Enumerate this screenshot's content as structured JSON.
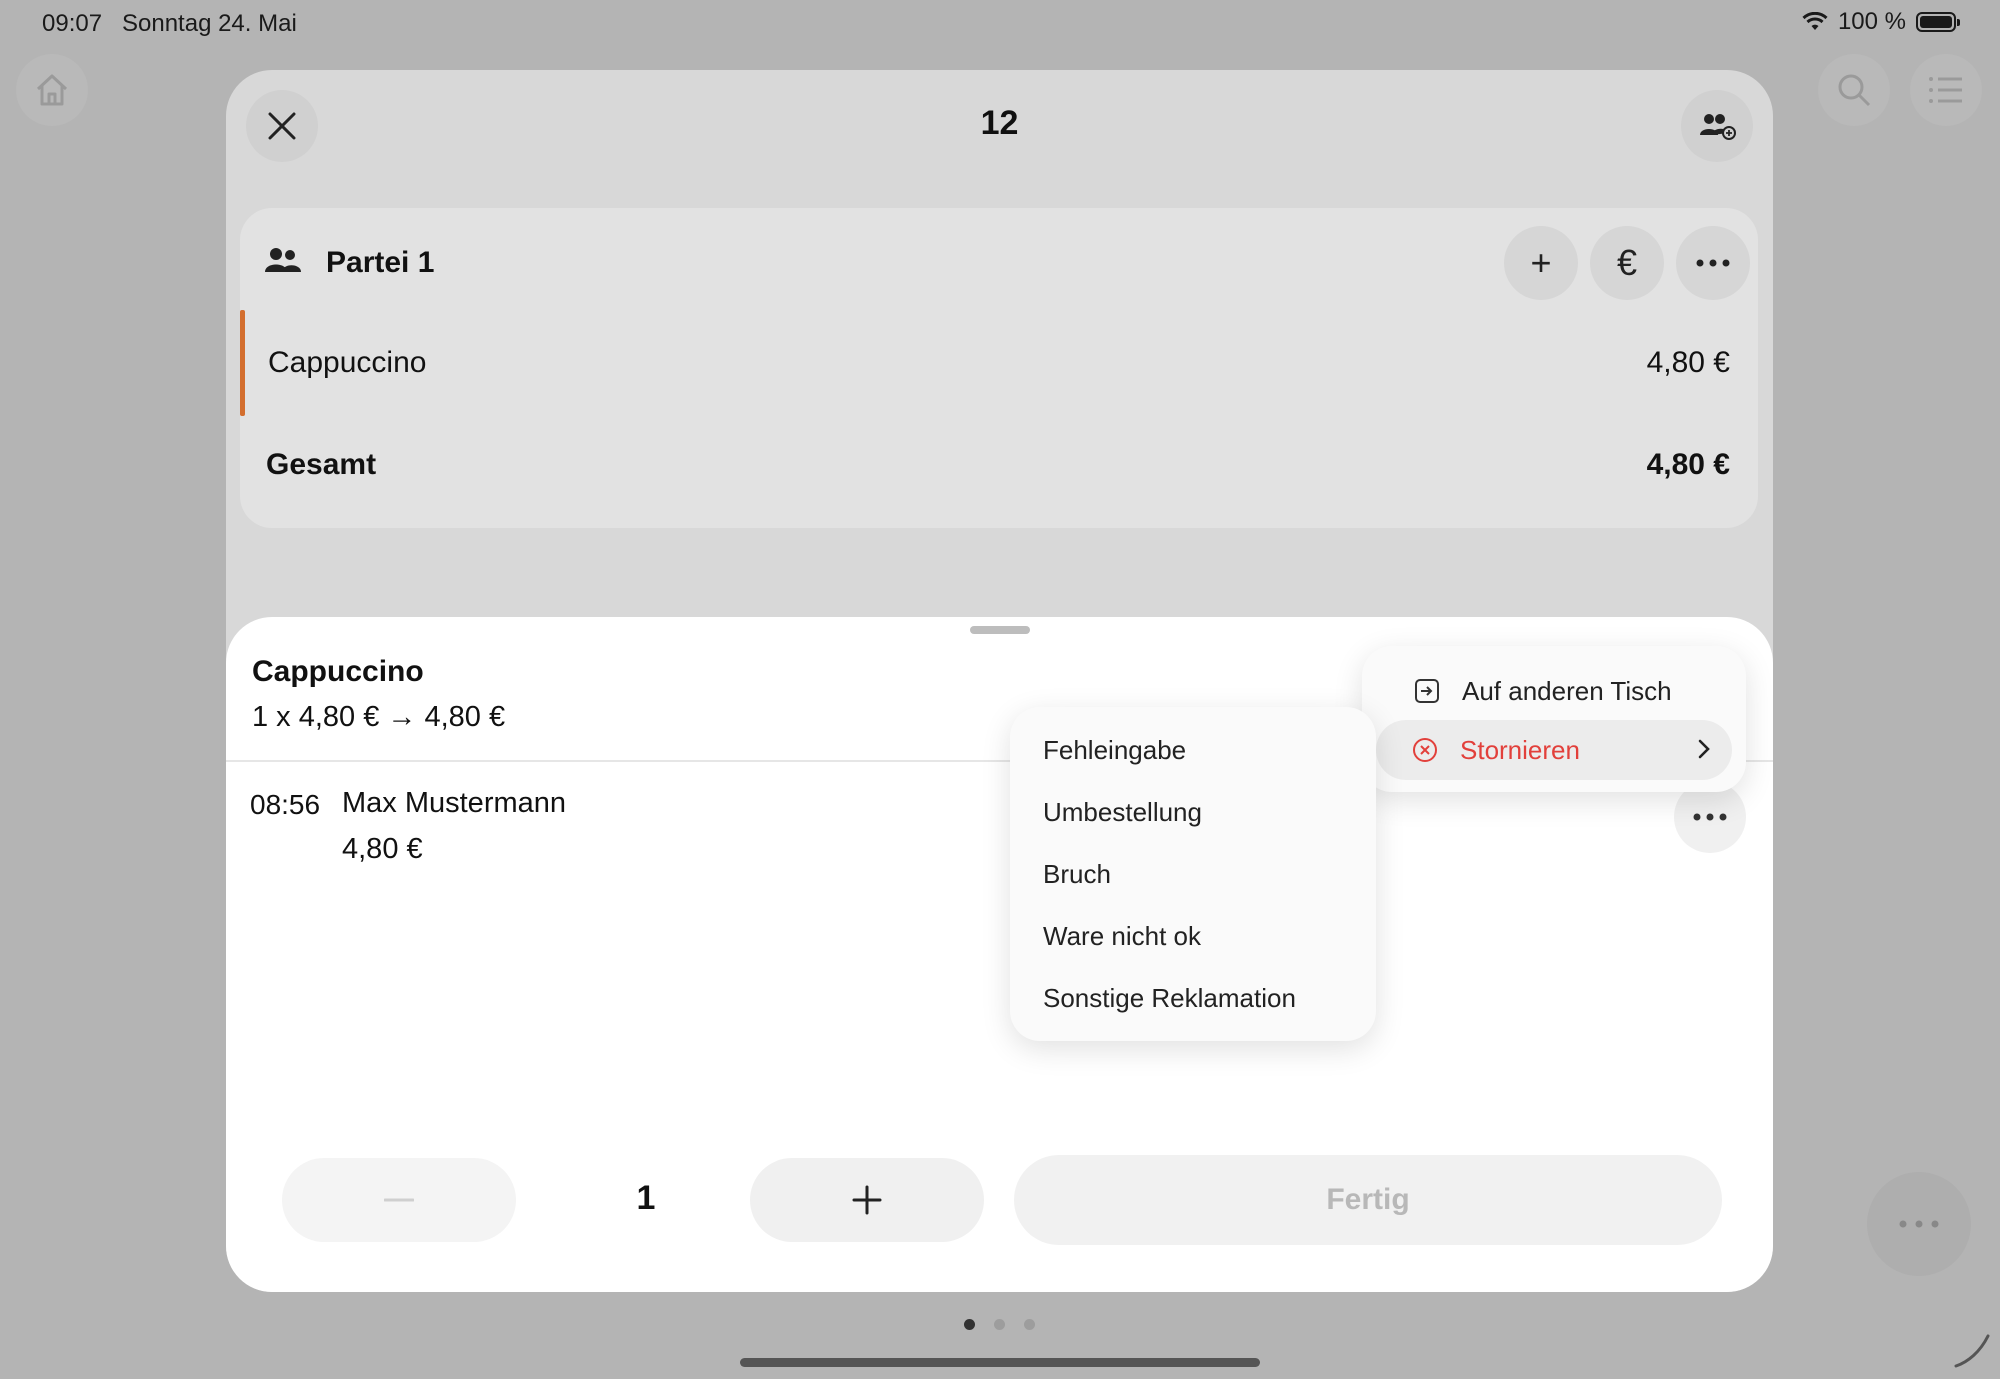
{
  "status_bar": {
    "time": "09:07",
    "date": "Sonntag 24. Mai",
    "battery": "100 %"
  },
  "modal": {
    "title": "12",
    "party": {
      "label": "Partei 1",
      "items": [
        {
          "name": "Cappuccino",
          "price": "4,80 €"
        }
      ],
      "total_label": "Gesamt",
      "total_price": "4,80 €",
      "actions": {
        "add": "+",
        "pay": "€"
      }
    }
  },
  "sheet": {
    "title": "Cappuccino",
    "calc": "1 x 4,80 € → 4,80 €",
    "order": {
      "time": "08:56",
      "waiter": "Max Mustermann",
      "price": "4,80 €"
    },
    "quantity": "1",
    "done_label": "Fertig"
  },
  "menu": {
    "move_label": "Auf anderen Tisch",
    "cancel_label": "Stornieren",
    "cancel_color": "#e2403b",
    "submenu": [
      "Fehleingabe",
      "Umbestellung",
      "Bruch",
      "Ware nicht ok",
      "Sonstige Reklamation"
    ]
  },
  "colors": {
    "accent": "#d36e2e",
    "destructive": "#e2403b"
  }
}
